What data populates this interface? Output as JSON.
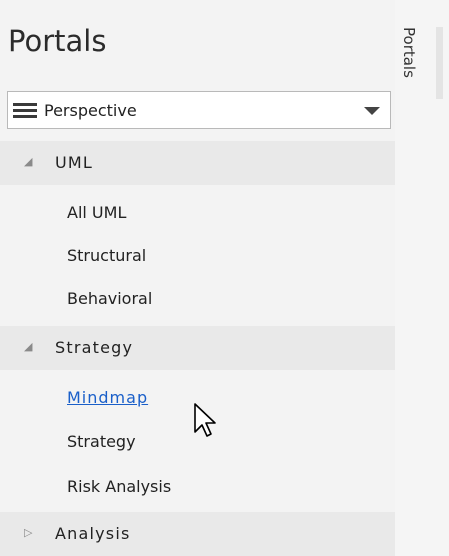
{
  "panel": {
    "title": "Portals",
    "perspective": {
      "label": "Perspective",
      "icon": "hamburger-icon",
      "arrow": "chevron-down-icon"
    },
    "groups": [
      {
        "label": "UML",
        "toggle": "◢",
        "expanded": true,
        "items": [
          {
            "label": "All UML",
            "link": false
          },
          {
            "label": "Structural",
            "link": false
          },
          {
            "label": "Behavioral",
            "link": false
          }
        ]
      },
      {
        "label": "Strategy",
        "toggle": "◢",
        "expanded": true,
        "items": [
          {
            "label": "Mindmap",
            "link": true
          },
          {
            "label": "Strategy",
            "link": false
          },
          {
            "label": "Risk Analysis",
            "link": false
          }
        ]
      },
      {
        "label": "Analysis",
        "toggle": "▷",
        "expanded": false,
        "items": []
      }
    ]
  },
  "side_tab": {
    "label": "Portals"
  },
  "colors": {
    "link": "#1a5fc9",
    "group_header_bg": "#e9e9e9",
    "panel_bg": "#f3f3f3"
  }
}
